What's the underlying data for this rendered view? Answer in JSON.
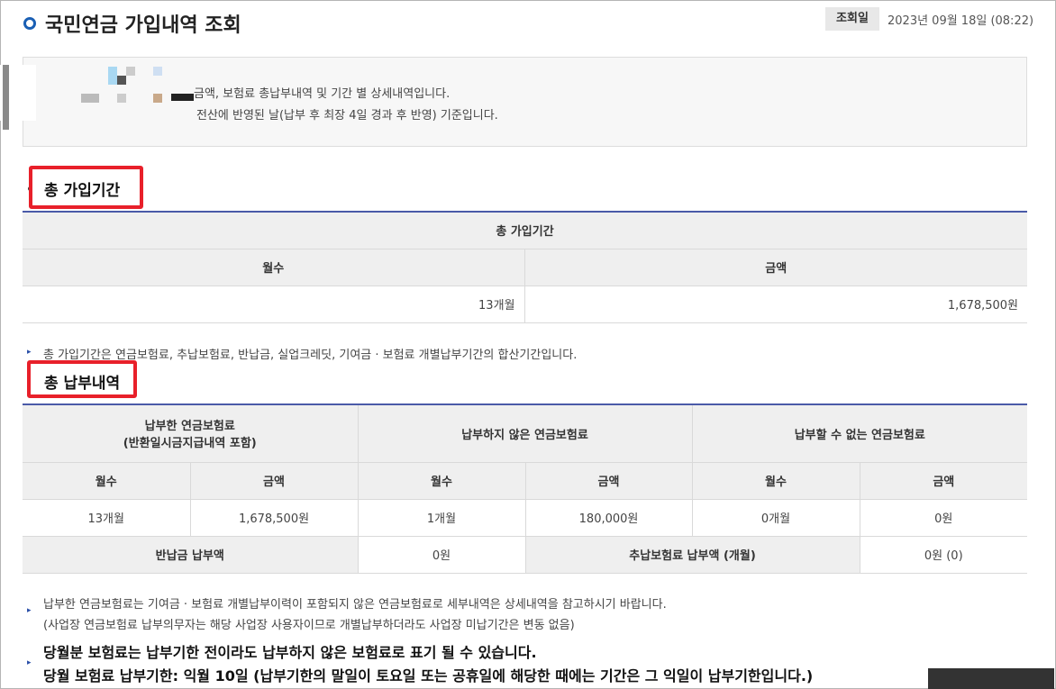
{
  "header": {
    "title": "국민연금 가입내역 조회",
    "date_label": "조회일",
    "date_value": "2023년 09월 18일 (08:22)"
  },
  "info": {
    "line1": "금액, 보험료 총납부내역 및 기간 별 상세내역입니다.",
    "line2": "전산에 반영된 날(납부 후 최장 4일 경과 후 반영) 기준입니다."
  },
  "section1": {
    "title": "총 가입기간",
    "table_header": "총 가입기간",
    "col_months": "월수",
    "col_amount": "금액",
    "months": "13개월",
    "amount": "1,678,500원",
    "note": "총 가입기간은 연금보험료, 추납보험료, 반납금, 실업크레딧, 기여금 · 보험료 개별납부기간의 합산기간입니다."
  },
  "section2": {
    "title": "총 납부내역",
    "group1": "납부한 연금보험료",
    "group1_sub": "(반환일시금지급내역 포함)",
    "group2": "납부하지 않은 연금보험료",
    "group3": "납부할 수 없는 연금보험료",
    "col_months": "월수",
    "col_amount": "금액",
    "row": [
      "13개월",
      "1,678,500원",
      "1개월",
      "180,000원",
      "0개월",
      "0원"
    ],
    "refund_label": "반납금 납부액",
    "refund_value": "0원",
    "extra_label": "추납보험료 납부액 (개월)",
    "extra_value": "0원 (0)"
  },
  "notes": {
    "note1": "납부한 연금보험료는 기여금 · 보험료 개별납부이력이 포함되지 않은 연금보험료로 세부내역은 상세내역을 참고하시기 바랍니다.",
    "note2": "(사업장 연금보험료 납부의무자는 해당 사업장 사용자이므로 개별납부하더라도 사업장 미납기간은 변동 없음)",
    "bold1": "당월분 보험료는 납부기한 전이라도 납부하지 않은 보험료로 표기 될 수 있습니다.",
    "bold2": "당월 보험료 납부기한: 익월 10일 (납부기한의 말일이 토요일 또는 공휴일에 해당한 때에는 기간은 그 익일이 납부기한입니다.)"
  },
  "colors": {
    "accent_blue": "#1a5fb4",
    "table_top_border": "#4a5aa8",
    "highlight_red": "#e8202a",
    "header_bg": "#efefef"
  }
}
